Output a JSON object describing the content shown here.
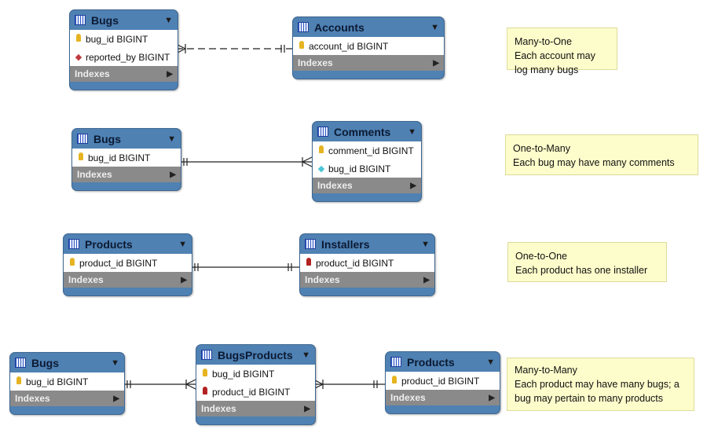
{
  "tables": [
    {
      "name": "Bugs",
      "columns": [
        {
          "icon": "primary-key",
          "text": "bug_id BIGINT"
        },
        {
          "icon": "foreign-key-diamond",
          "text": "reported_by BIGINT"
        }
      ],
      "indexes": "Indexes"
    },
    {
      "name": "Accounts",
      "columns": [
        {
          "icon": "primary-key",
          "text": "account_id BIGINT"
        }
      ],
      "indexes": "Indexes"
    },
    {
      "name": "Bugs",
      "columns": [
        {
          "icon": "primary-key",
          "text": "bug_id BIGINT"
        }
      ],
      "indexes": "Indexes"
    },
    {
      "name": "Comments",
      "columns": [
        {
          "icon": "primary-key",
          "text": "comment_id BIGINT"
        },
        {
          "icon": "column-diamond",
          "text": "bug_id BIGINT"
        }
      ],
      "indexes": "Indexes"
    },
    {
      "name": "Products",
      "columns": [
        {
          "icon": "primary-key",
          "text": "product_id BIGINT"
        }
      ],
      "indexes": "Indexes"
    },
    {
      "name": "Installers",
      "columns": [
        {
          "icon": "primary-foreign-key",
          "text": "product_id BIGINT"
        }
      ],
      "indexes": "Indexes"
    },
    {
      "name": "Bugs",
      "columns": [
        {
          "icon": "primary-key",
          "text": "bug_id BIGINT"
        }
      ],
      "indexes": "Indexes"
    },
    {
      "name": "BugsProducts",
      "columns": [
        {
          "icon": "primary-key",
          "text": "bug_id BIGINT"
        },
        {
          "icon": "primary-foreign-key",
          "text": "product_id BIGINT"
        }
      ],
      "indexes": "Indexes"
    },
    {
      "name": "Products",
      "columns": [
        {
          "icon": "primary-key",
          "text": "product_id BIGINT"
        }
      ],
      "indexes": "Indexes"
    }
  ],
  "notes": [
    {
      "title": "Many-to-One",
      "text": "Each account may log many bugs"
    },
    {
      "title": "One-to-Many",
      "text": "Each bug may have many comments"
    },
    {
      "title": "One-to-One",
      "text": "Each product has one installer"
    },
    {
      "title": "Many-to-Many",
      "text": "Each product may have many bugs; a bug may pertain to many products"
    }
  ],
  "relationships": [
    {
      "from": "Bugs",
      "to": "Accounts",
      "type": "many-to-one",
      "style": "dashed"
    },
    {
      "from": "Bugs",
      "to": "Comments",
      "type": "one-to-many",
      "style": "solid"
    },
    {
      "from": "Products",
      "to": "Installers",
      "type": "one-to-one",
      "style": "solid"
    },
    {
      "from": "Bugs",
      "to": "BugsProducts",
      "type": "one-to-many",
      "style": "solid"
    },
    {
      "from": "BugsProducts",
      "to": "Products",
      "type": "many-to-one",
      "style": "solid"
    }
  ],
  "colors": {
    "header": "#4f81b3",
    "indexes": "#8a8a8a",
    "note": "#fdfccb"
  }
}
